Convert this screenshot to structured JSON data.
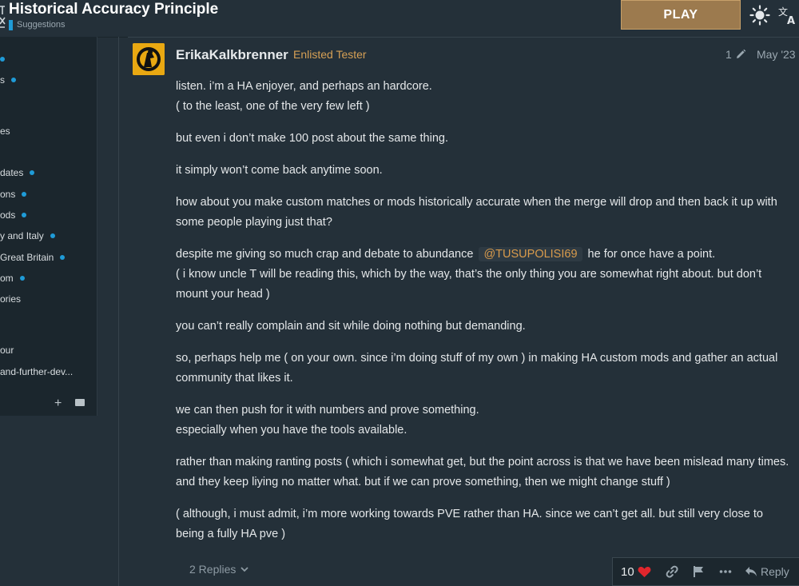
{
  "header": {
    "title": "Historical Accuracy Principle",
    "category": "Suggestions",
    "play_label": "PLAY",
    "category_color": "#1f9bd7",
    "play_color": "#9c7a4e"
  },
  "sidebar": {
    "items": [
      {
        "label": "",
        "dot": true
      },
      {
        "label": "s",
        "dot": true
      },
      {
        "label": "es",
        "dot": false
      },
      {
        "label": "dates",
        "dot": true
      },
      {
        "label": "ons",
        "dot": true
      },
      {
        "label": "ods",
        "dot": true
      },
      {
        "label": "y and Italy",
        "dot": true
      },
      {
        "label": " Great Britain",
        "dot": true
      },
      {
        "label": "om",
        "dot": true
      },
      {
        "label": "ories",
        "dot": false
      },
      {
        "label": "our",
        "dot": false
      },
      {
        "label": "and-further-dev...",
        "dot": false
      }
    ]
  },
  "post": {
    "username": "ErikaKalkbrenner",
    "user_title": "Enlisted Tester",
    "edit_count": "1",
    "date": "May '23",
    "paragraphs": [
      [
        "listen. i’m a HA enjoyer, and perhaps an hardcore.",
        "( to the least, one of the very few left )"
      ],
      [
        "but even i don’t make 100 post about the same thing."
      ],
      [
        "it simply won’t come back anytime soon."
      ],
      [
        "how about you make custom matches or mods historically accurate when the merge will drop and then back it up with some people playing just that?"
      ],
      [
        "( i know uncle T will be reading this, which by the way, that’s the only thing you are somewhat right about. but don’t mount your head )"
      ],
      [
        "you can’t really complain and sit while doing nothing but demanding."
      ],
      [
        "so, perhaps help me ( on your own. since i’m doing stuff of my own ) in making HA custom mods and gather an actual community that likes it."
      ],
      [
        "we can then push for it with numbers and prove something.",
        "especially when you have the tools available."
      ],
      [
        "rather than making ranting posts ( which i somewhat get, but the point across is that we have been mislead many times. and they keep liying no matter what. but if we can prove something, then we might change stuff )"
      ],
      [
        "( although, i must admit, i’m more working towards PVE rather than HA. since we can’t get all. but still very close to being a fully HA pve )"
      ]
    ],
    "mention_line": {
      "before": "despite me giving so much crap and debate to abundance",
      "mention": "@TUSUPOLISI69",
      "after": "he for once have a point."
    },
    "replies_label": "2 Replies",
    "like_count": "10",
    "reply_label": "Reply",
    "heart_color": "#e0262d"
  }
}
